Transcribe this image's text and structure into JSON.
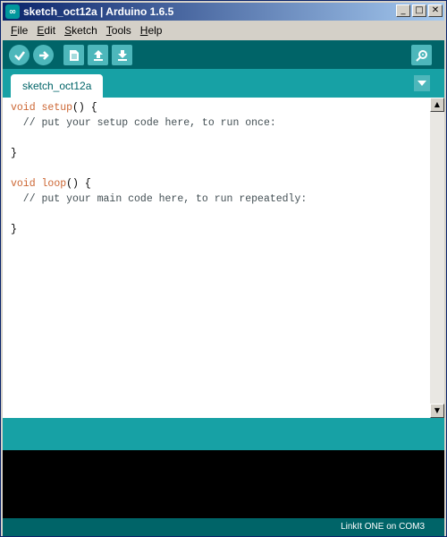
{
  "window": {
    "title": "sketch_oct12a | Arduino 1.6.5",
    "controls": [
      "minimize",
      "maximize",
      "close"
    ]
  },
  "menu": [
    {
      "label": "File",
      "mnemonic": "F",
      "rest": "ile"
    },
    {
      "label": "Edit",
      "mnemonic": "E",
      "rest": "dit"
    },
    {
      "label": "Sketch",
      "mnemonic": "S",
      "rest": "ketch"
    },
    {
      "label": "Tools",
      "mnemonic": "T",
      "rest": "ools"
    },
    {
      "label": "Help",
      "mnemonic": "H",
      "rest": "elp"
    }
  ],
  "toolbar": {
    "buttons": [
      "verify-icon",
      "upload-icon",
      "new-icon",
      "open-icon",
      "save-icon"
    ],
    "right_button": "serial-monitor-icon"
  },
  "tabs": [
    {
      "label": "sketch_oct12a",
      "active": true
    }
  ],
  "editor": {
    "lines": [
      {
        "kw": "void",
        "fn": "setup",
        "rest": "() {"
      },
      {
        "comment": "  // put your setup code here, to run once:"
      },
      {
        "text": ""
      },
      {
        "text": "}"
      },
      {
        "text": ""
      },
      {
        "kw": "void",
        "fn": "loop",
        "rest": "() {"
      },
      {
        "comment": "  // put your main code here, to run repeatedly:"
      },
      {
        "text": ""
      },
      {
        "text": "}"
      }
    ]
  },
  "status": {
    "board": "LinkIt ONE on COM3"
  },
  "colors": {
    "toolbar": "#006468",
    "tabbar": "#17a1a5",
    "button": "#4db7bb",
    "keyword": "#cc6633"
  }
}
